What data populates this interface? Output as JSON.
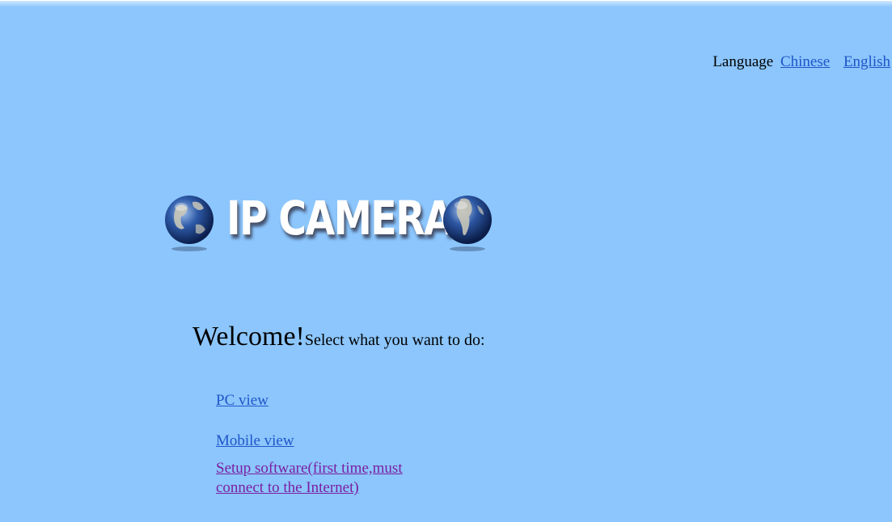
{
  "header": {
    "language_label": "Language",
    "languages": [
      {
        "label": "Chinese"
      },
      {
        "label": "English"
      }
    ]
  },
  "logo": {
    "title": "IP CAMERA",
    "icons": [
      "globe-icon",
      "globe-icon"
    ]
  },
  "welcome": {
    "greeting": "Welcome!",
    "prompt": "Select what you want to do:"
  },
  "options": [
    {
      "label": "PC view"
    },
    {
      "label": "Mobile view"
    },
    {
      "label": "Setup software(first time,must connect to the Internet)"
    }
  ],
  "colors": {
    "background": "#8CC6FD",
    "link": "#1f56c8",
    "visited_link": "#7a1fa2"
  }
}
